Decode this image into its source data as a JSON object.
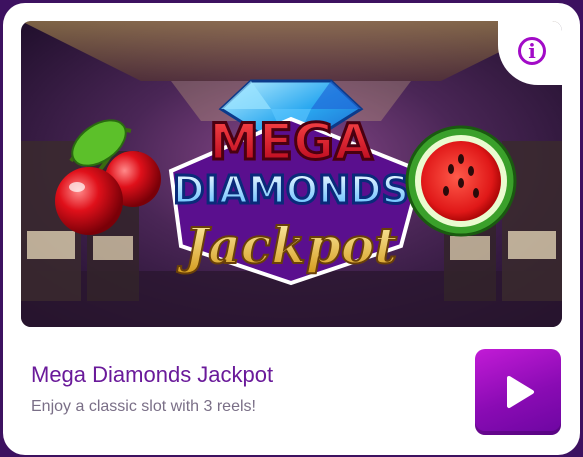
{
  "game": {
    "name": "Mega Diamonds Jackpot",
    "description": "Enjoy a classic slot with 3 reels!",
    "logo_lines": [
      "MEGA",
      "DIAMONDS",
      "Jackpot"
    ]
  },
  "icons": {
    "info": "info-icon",
    "play": "play-icon"
  },
  "colors": {
    "page_bg": "#3d1160",
    "accent": "#a20bc7",
    "title": "#6a1a9a",
    "subtitle": "#7a6f87"
  }
}
